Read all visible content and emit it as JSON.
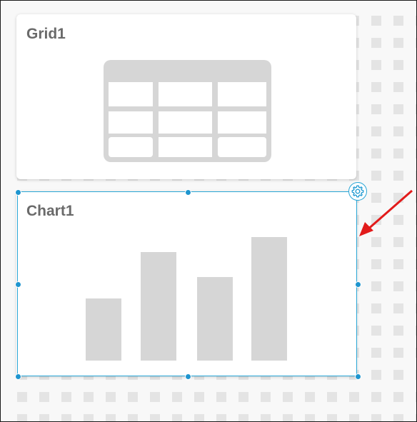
{
  "grid_widget": {
    "title": "Grid1"
  },
  "chart_widget": {
    "title": "Chart1"
  },
  "colors": {
    "canvas_bg": "#f8f8f8",
    "canvas_dot": "#e4e4e4",
    "card_bg": "#ffffff",
    "placeholder_gray": "#d6d6d6",
    "selection_blue": "#2aa6d6",
    "handle_blue": "#1e95cf",
    "arrow_red": "#e21b1b",
    "title_gray": "#6a6a6a"
  },
  "icons": {
    "grid_placeholder": "table-placeholder-icon",
    "chart_placeholder": "bar-chart-placeholder-icon",
    "settings": "gear-icon",
    "annotation": "red-arrow"
  }
}
